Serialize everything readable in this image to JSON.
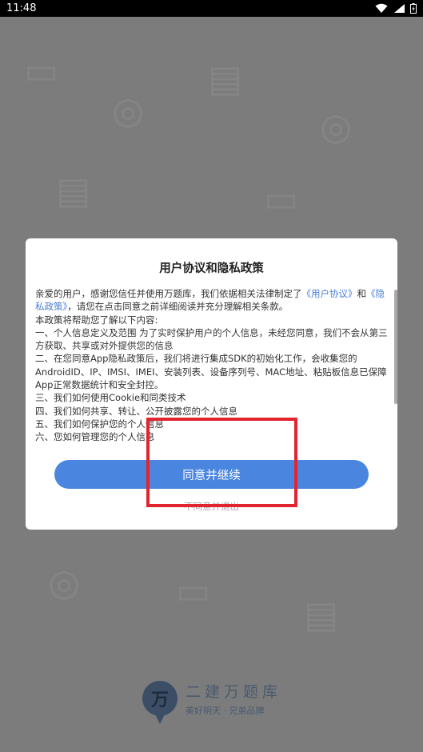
{
  "status_bar": {
    "time": "11:48"
  },
  "brand": {
    "logo_char": "万",
    "name": "二建万题库",
    "tagline": "美好明天 · 兄弟品牌"
  },
  "dialog": {
    "title": "用户协议和隐私政策",
    "intro_prefix": "亲爱的用户，感谢您信任并使用万题库，我们依据相关法律制定了",
    "link_user_agreement": "《用户协议》",
    "intro_and": "和",
    "link_privacy_policy": "《隐私政策》",
    "intro_suffix": "，请您在点击同意之前详细阅读并充分理解相关条款。",
    "lines": [
      "本政策将帮助您了解以下内容:",
      "一、个人信息定义及范围 为了实时保护用户的个人信息，未经您同意，我们不会从第三方获取、共享或对外提供您的信息",
      "二、在您同意App隐私政策后，我们将进行集成SDK的初始化工作，会收集您的AndroidID、IP、IMSI、IMEI、安装列表、设备序列号、MAC地址、粘贴板信息已保障App正常数据统计和安全封控。",
      "三、我们如何使用Cookie和同类技术",
      "四、我们如何共享、转让、公开披露您的个人信息",
      "五、我们如何保护您的个人信息",
      "六、您如何管理您的个人信息"
    ],
    "agree_label": "同意并继续",
    "disagree_label": "不同意并退出"
  },
  "colors": {
    "link": "#4a7fd4",
    "button": "#4a86e0",
    "highlight": "#e2242f"
  }
}
